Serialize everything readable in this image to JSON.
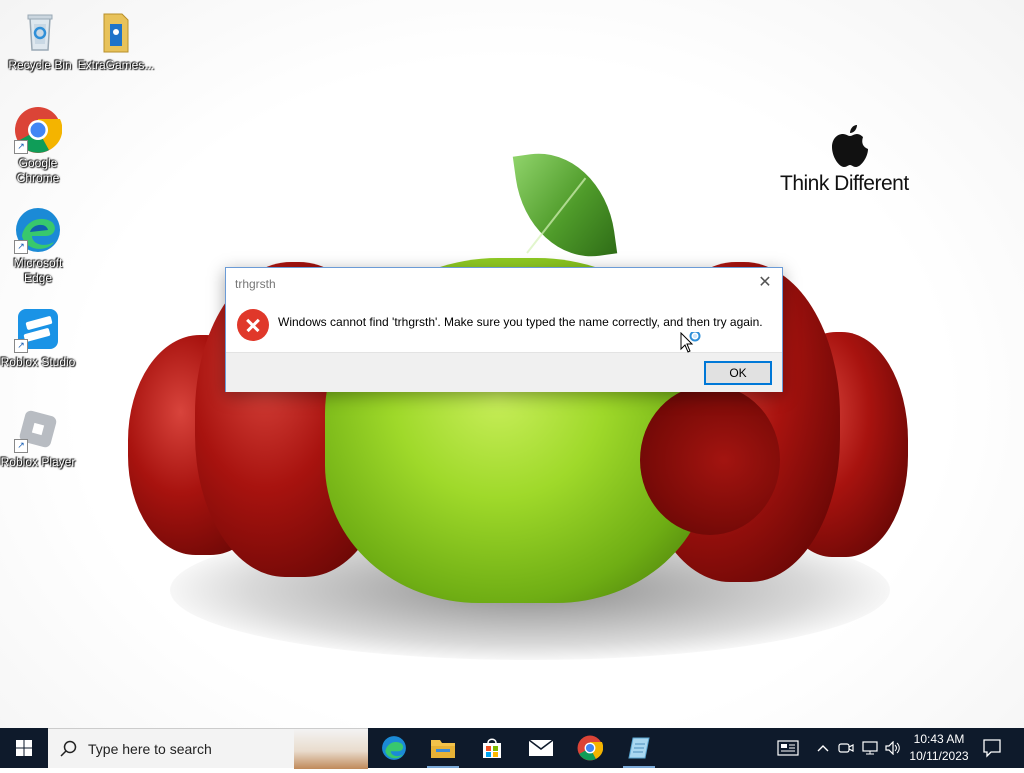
{
  "desktop": {
    "icons": [
      {
        "label": "Recycle Bin",
        "icon": "recycle-bin-icon"
      },
      {
        "label": "ExtraGames...",
        "icon": "folder-icon"
      },
      {
        "label": "Google Chrome",
        "icon": "chrome-icon"
      },
      {
        "label": "Microsoft Edge",
        "icon": "edge-icon"
      },
      {
        "label": "Roblox Studio",
        "icon": "roblox-studio-icon"
      },
      {
        "label": "Roblox Player",
        "icon": "roblox-player-icon"
      }
    ],
    "wallpaper": {
      "brand_text": "Think Different"
    }
  },
  "dialog": {
    "title": "trhgrsth",
    "message": "Windows cannot find 'trhgrsth'. Make sure you typed the name correctly, and then try again.",
    "ok_label": "OK",
    "close_glyph": "✕"
  },
  "taskbar": {
    "search_placeholder": "Type here to search",
    "apps": [
      "edge-icon",
      "file-explorer-icon",
      "microsoft-store-icon",
      "mail-icon",
      "chrome-icon",
      "notepad-icon"
    ],
    "tray": [
      "news-icon",
      "chevron-up-icon",
      "meet-icon",
      "network-icon",
      "volume-icon"
    ],
    "time": "10:43 AM",
    "date": "10/11/2023"
  },
  "colors": {
    "accent": "#0078d7",
    "taskbar": "#0e1a2b",
    "error": "#e0382a"
  }
}
